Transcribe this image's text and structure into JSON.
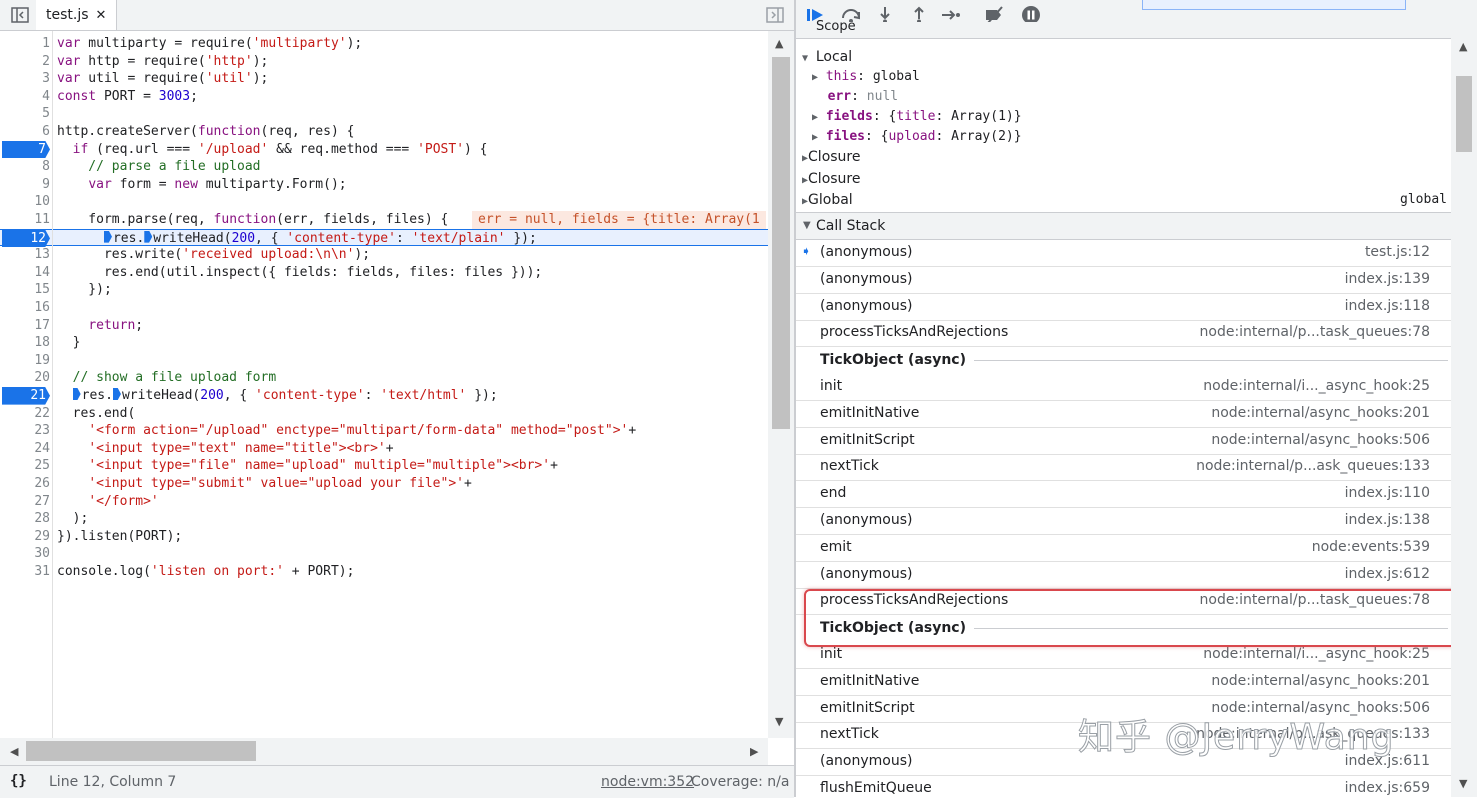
{
  "editor": {
    "tab_label": "test.js",
    "tab_close": "✕",
    "lines": [
      {
        "n": "1",
        "t": "var multiparty = require('multiparty');"
      },
      {
        "n": "2",
        "t": "var http = require('http');"
      },
      {
        "n": "3",
        "t": "var util = require('util');"
      },
      {
        "n": "4",
        "t": "const PORT = 3003;"
      },
      {
        "n": "5",
        "t": ""
      },
      {
        "n": "6",
        "t": "http.createServer(function(req, res) {"
      },
      {
        "n": "7",
        "t": "  if (req.url === '/upload' && req.method === 'POST') {",
        "bp": true
      },
      {
        "n": "8",
        "t": "    // parse a file upload"
      },
      {
        "n": "9",
        "t": "    var form = new multiparty.Form();"
      },
      {
        "n": "10",
        "t": ""
      },
      {
        "n": "11",
        "t": "    form.parse(req, function(err, fields, files) {",
        "inline": "err = null, fields = {title: Array(1"
      },
      {
        "n": "12",
        "t": "      ▶res.▶writeHead(200, { 'content-type': 'text/plain' });",
        "bp": true,
        "current": true
      },
      {
        "n": "13",
        "t": "      res.write('received upload:\\n\\n');"
      },
      {
        "n": "14",
        "t": "      res.end(util.inspect({ fields: fields, files: files }));"
      },
      {
        "n": "15",
        "t": "    });"
      },
      {
        "n": "16",
        "t": ""
      },
      {
        "n": "17",
        "t": "    return;"
      },
      {
        "n": "18",
        "t": "  }"
      },
      {
        "n": "19",
        "t": ""
      },
      {
        "n": "20",
        "t": "  // show a file upload form"
      },
      {
        "n": "21",
        "t": "  ▶res.▶writeHead(200, { 'content-type': 'text/html' });",
        "bp": true
      },
      {
        "n": "22",
        "t": "  res.end("
      },
      {
        "n": "23",
        "t": "    '<form action=\"/upload\" enctype=\"multipart/form-data\" method=\"post\">'+"
      },
      {
        "n": "24",
        "t": "    '<input type=\"text\" name=\"title\"><br>'+"
      },
      {
        "n": "25",
        "t": "    '<input type=\"file\" name=\"upload\" multiple=\"multiple\"><br>'+"
      },
      {
        "n": "26",
        "t": "    '<input type=\"submit\" value=\"upload your file\">'+"
      },
      {
        "n": "27",
        "t": "    '</form>'"
      },
      {
        "n": "28",
        "t": "  );"
      },
      {
        "n": "29",
        "t": "}).listen(PORT);"
      },
      {
        "n": "30",
        "t": ""
      },
      {
        "n": "31",
        "t": "console.log('listen on port:' + PORT);"
      }
    ]
  },
  "status": {
    "pretty_print": "{}",
    "position": "Line 12, Column 7",
    "script_link": "node:vm:352",
    "coverage": "Coverage: n/a"
  },
  "scope": {
    "header": "Scope",
    "local_label": "Local",
    "vars": [
      {
        "key": "this",
        "sep": ": ",
        "val": "global",
        "expandable": true,
        "bold": false
      },
      {
        "key": "err",
        "sep": ": ",
        "val": "null",
        "expandable": false,
        "bold": true
      },
      {
        "key": "fields",
        "sep": ": ",
        "val": "{title: Array(1)}",
        "expandable": true,
        "bold": true
      },
      {
        "key": "files",
        "sep": ": ",
        "val": "{upload: Array(2)}",
        "expandable": true,
        "bold": true
      }
    ],
    "closure1": "Closure",
    "closure2": "Closure",
    "global_label": "Global",
    "global_value": "global"
  },
  "call_stack": {
    "header": "Call Stack",
    "items": [
      {
        "type": "frame",
        "name": "(anonymous)",
        "loc": "test.js:12",
        "current": true
      },
      {
        "type": "frame",
        "name": "(anonymous)",
        "loc": "index.js:139"
      },
      {
        "type": "frame",
        "name": "(anonymous)",
        "loc": "index.js:118"
      },
      {
        "type": "frame",
        "name": "processTicksAndRejections",
        "loc": "node:internal/p...task_queues:78"
      },
      {
        "type": "async",
        "name": "TickObject (async)"
      },
      {
        "type": "frame",
        "name": "init",
        "loc": "node:internal/i..._async_hook:25"
      },
      {
        "type": "frame",
        "name": "emitInitNative",
        "loc": "node:internal/async_hooks:201"
      },
      {
        "type": "frame",
        "name": "emitInitScript",
        "loc": "node:internal/async_hooks:506"
      },
      {
        "type": "frame",
        "name": "nextTick",
        "loc": "node:internal/p...ask_queues:133"
      },
      {
        "type": "frame",
        "name": "end",
        "loc": "index.js:110"
      },
      {
        "type": "frame",
        "name": "(anonymous)",
        "loc": "index.js:138"
      },
      {
        "type": "frame",
        "name": "emit",
        "loc": "node:events:539"
      },
      {
        "type": "frame",
        "name": "(anonymous)",
        "loc": "index.js:612"
      },
      {
        "type": "frame",
        "name": "processTicksAndRejections",
        "loc": "node:internal/p...task_queues:78"
      },
      {
        "type": "async",
        "name": "TickObject (async)"
      },
      {
        "type": "frame",
        "name": "init",
        "loc": "node:internal/i..._async_hook:25"
      },
      {
        "type": "frame",
        "name": "emitInitNative",
        "loc": "node:internal/async_hooks:201"
      },
      {
        "type": "frame",
        "name": "emitInitScript",
        "loc": "node:internal/async_hooks:506"
      },
      {
        "type": "frame",
        "name": "nextTick",
        "loc": "node:internal/p...ask_queues:133"
      },
      {
        "type": "frame",
        "name": "(anonymous)",
        "loc": "index.js:611"
      },
      {
        "type": "frame",
        "name": "flushEmitQueue",
        "loc": "index.js:659"
      }
    ]
  },
  "watermark": "知乎 @JerryWang",
  "colors": {
    "accent": "#1a73e8",
    "highlight": "#d9484d",
    "keyword": "#881280",
    "string": "#c41a16",
    "comment": "#236e25",
    "number": "#1c00cf"
  }
}
